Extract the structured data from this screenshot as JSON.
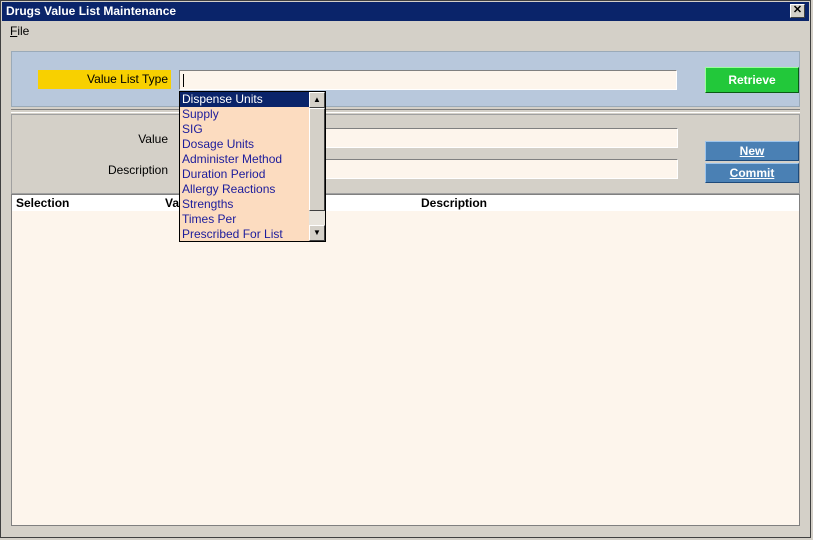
{
  "window": {
    "title": "Drugs Value List Maintenance",
    "close_glyph": "✕"
  },
  "menu": {
    "file_label": "File",
    "file_mnemonic": "F",
    "file_rest": "ile"
  },
  "form": {
    "value_list_type_label": "Value List Type",
    "value_list_type_value": "",
    "value_label": "Value",
    "value_value": "",
    "description_label": "Description",
    "description_value": "",
    "retrieve_label": "Retrieve",
    "new_label": "New",
    "commit_label": "Commit"
  },
  "dropdown": {
    "options": [
      "Dispense Units",
      "Supply",
      "SIG",
      "Dosage Units",
      "Administer Method",
      "Duration Period",
      "Allergy Reactions",
      "Strengths",
      "Times Per",
      "Prescribed For List"
    ],
    "selected_index": 0
  },
  "grid": {
    "columns": [
      "Selection",
      "Va",
      "Description"
    ]
  },
  "colors": {
    "titlebar": "#0a246a",
    "label_highlight": "#f8d000",
    "retrieve_button": "#22c83a",
    "action_button": "#4a80b4",
    "dropdown_bg": "#fcdcc0",
    "dropdown_text": "#1c1c9c",
    "input_bg": "#fdf5ec",
    "top_panel": "#b8c8dc"
  }
}
